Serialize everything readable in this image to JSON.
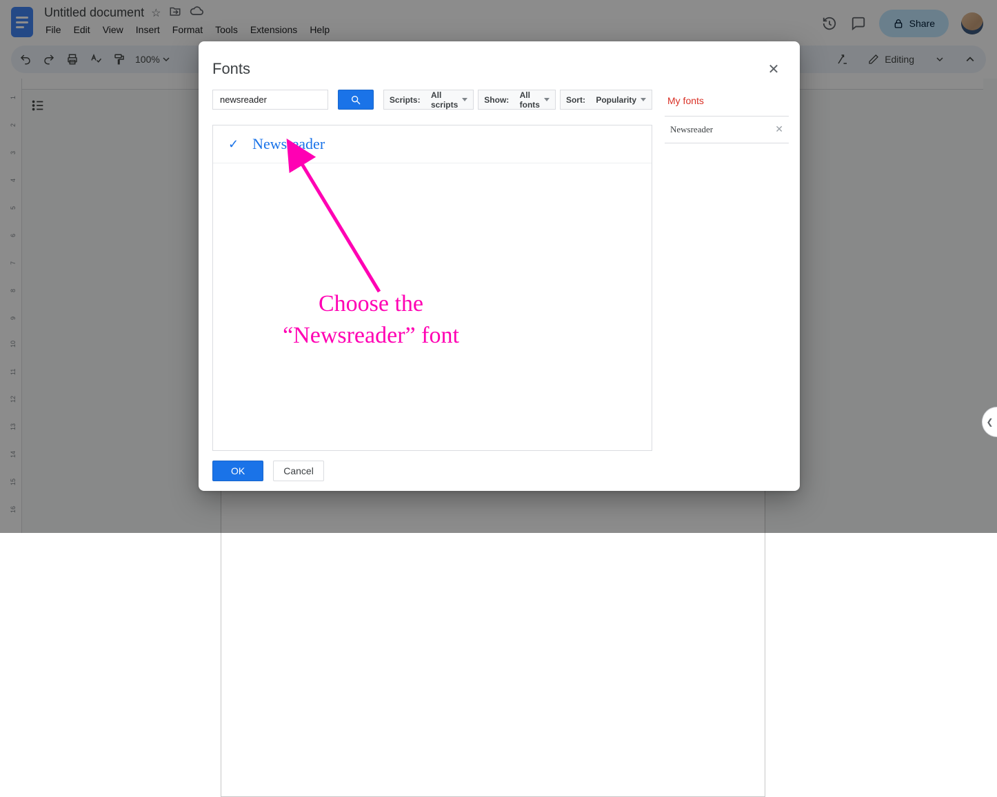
{
  "app": {
    "docTitle": "Untitled document",
    "menus": [
      "File",
      "Edit",
      "View",
      "Insert",
      "Format",
      "Tools",
      "Extensions",
      "Help"
    ],
    "zoom": "100%",
    "share": "Share",
    "editing": "Editing",
    "rulerTicks": [
      "1",
      "2",
      "3",
      "4",
      "5",
      "6",
      "7",
      "8",
      "9",
      "10",
      "11",
      "12",
      "13",
      "14",
      "15",
      "16"
    ]
  },
  "dialog": {
    "title": "Fonts",
    "searchValue": "newsreader",
    "filters": {
      "scripts": {
        "label": "Scripts:",
        "value": "All scripts"
      },
      "show": {
        "label": "Show:",
        "value": "All fonts"
      },
      "sort": {
        "label": "Sort:",
        "value": "Popularity"
      }
    },
    "results": [
      {
        "name": "Newsreader",
        "selected": true
      }
    ],
    "myFontsTitle": "My fonts",
    "myFonts": [
      "Newsreader"
    ],
    "ok": "OK",
    "cancel": "Cancel"
  },
  "annotation": {
    "line1": "Choose the",
    "line2": "“Newsreader” font"
  }
}
